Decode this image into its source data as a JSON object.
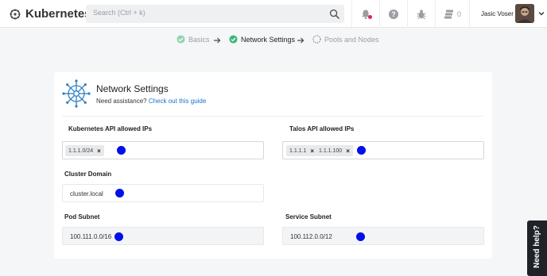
{
  "app": {
    "name": "Kubernetes"
  },
  "search": {
    "placeholder": "Search (Ctrl + k)"
  },
  "topbar": {
    "cluster_count": "0"
  },
  "user": {
    "name": "Jasic Voser"
  },
  "steps": [
    {
      "label": "Basics",
      "status": "done"
    },
    {
      "label": "Network Settings",
      "status": "active"
    },
    {
      "label": "Pools and Nodes",
      "status": "pending"
    }
  ],
  "card": {
    "title": "Network Settings",
    "assist_prefix": "Need assistance?",
    "assist_link": "Check out this guide"
  },
  "fields": {
    "k8s_ips": {
      "label": "Kubernetes API allowed IPs",
      "chips": [
        "1.1.1.0/24"
      ]
    },
    "talos_ips": {
      "label": "Talos API allowed IPs",
      "chips": [
        "1.1.1.1",
        "1.1.1.100"
      ]
    },
    "cluster_domain": {
      "label": "Cluster Domain",
      "value": "cluster.local"
    },
    "pod_subnet": {
      "label": "Pod Subnet",
      "value": "100.111.0.0/16"
    },
    "service_subnet": {
      "label": "Service Subnet",
      "value": "100.112.0.0/12"
    }
  },
  "chip_remove": "×",
  "help": {
    "label": "Need help?"
  },
  "colors": {
    "accent": "#1a73c8",
    "success": "#3cb878",
    "marker": "#0010e8"
  },
  "icons": [
    "kubernetes-logo-icon",
    "search-icon",
    "bell-icon",
    "help-circle-icon",
    "bug-icon",
    "server-stack-icon",
    "chevron-down-icon",
    "check-circle-icon",
    "arrow-right-icon",
    "dashed-circle-icon",
    "helm-wheel-icon"
  ]
}
